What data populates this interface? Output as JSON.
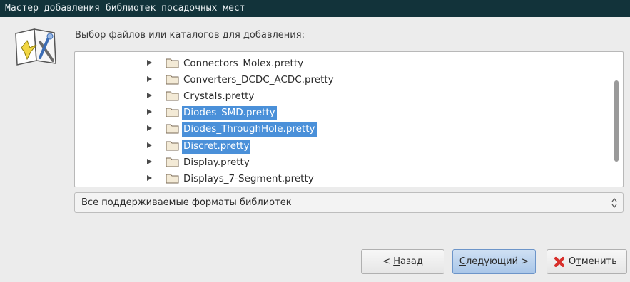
{
  "window": {
    "title": "Мастер добавления библиотек посадочных мест"
  },
  "prompt": "Выбор файлов или каталогов для добавления:",
  "tree": {
    "items": [
      {
        "label": "Connectors_Molex.pretty",
        "selected": false
      },
      {
        "label": "Converters_DCDC_ACDC.pretty",
        "selected": false
      },
      {
        "label": "Crystals.pretty",
        "selected": false
      },
      {
        "label": "Diodes_SMD.pretty",
        "selected": true
      },
      {
        "label": "Diodes_ThroughHole.pretty",
        "selected": true
      },
      {
        "label": "Discret.pretty",
        "selected": true
      },
      {
        "label": "Display.pretty",
        "selected": false
      },
      {
        "label": "Displays_7-Segment.pretty",
        "selected": false
      }
    ]
  },
  "format_select": {
    "value": "Все поддерживаемые форматы библиотек"
  },
  "buttons": {
    "back": {
      "prefix": "< ",
      "accel": "Н",
      "rest": "азад"
    },
    "next": {
      "accel": "С",
      "rest": "ледующий >"
    },
    "cancel": {
      "pre": "О",
      "accel": "т",
      "rest": "менить"
    }
  },
  "colors": {
    "titlebar": "#12333a",
    "selection": "#4a90d9",
    "folder": "#f3ead6"
  },
  "icons": {
    "wizard": "wizard-book-icon",
    "folder": "folder-icon",
    "expander": "expander-arrow-icon",
    "cancel": "cancel-x-icon"
  }
}
